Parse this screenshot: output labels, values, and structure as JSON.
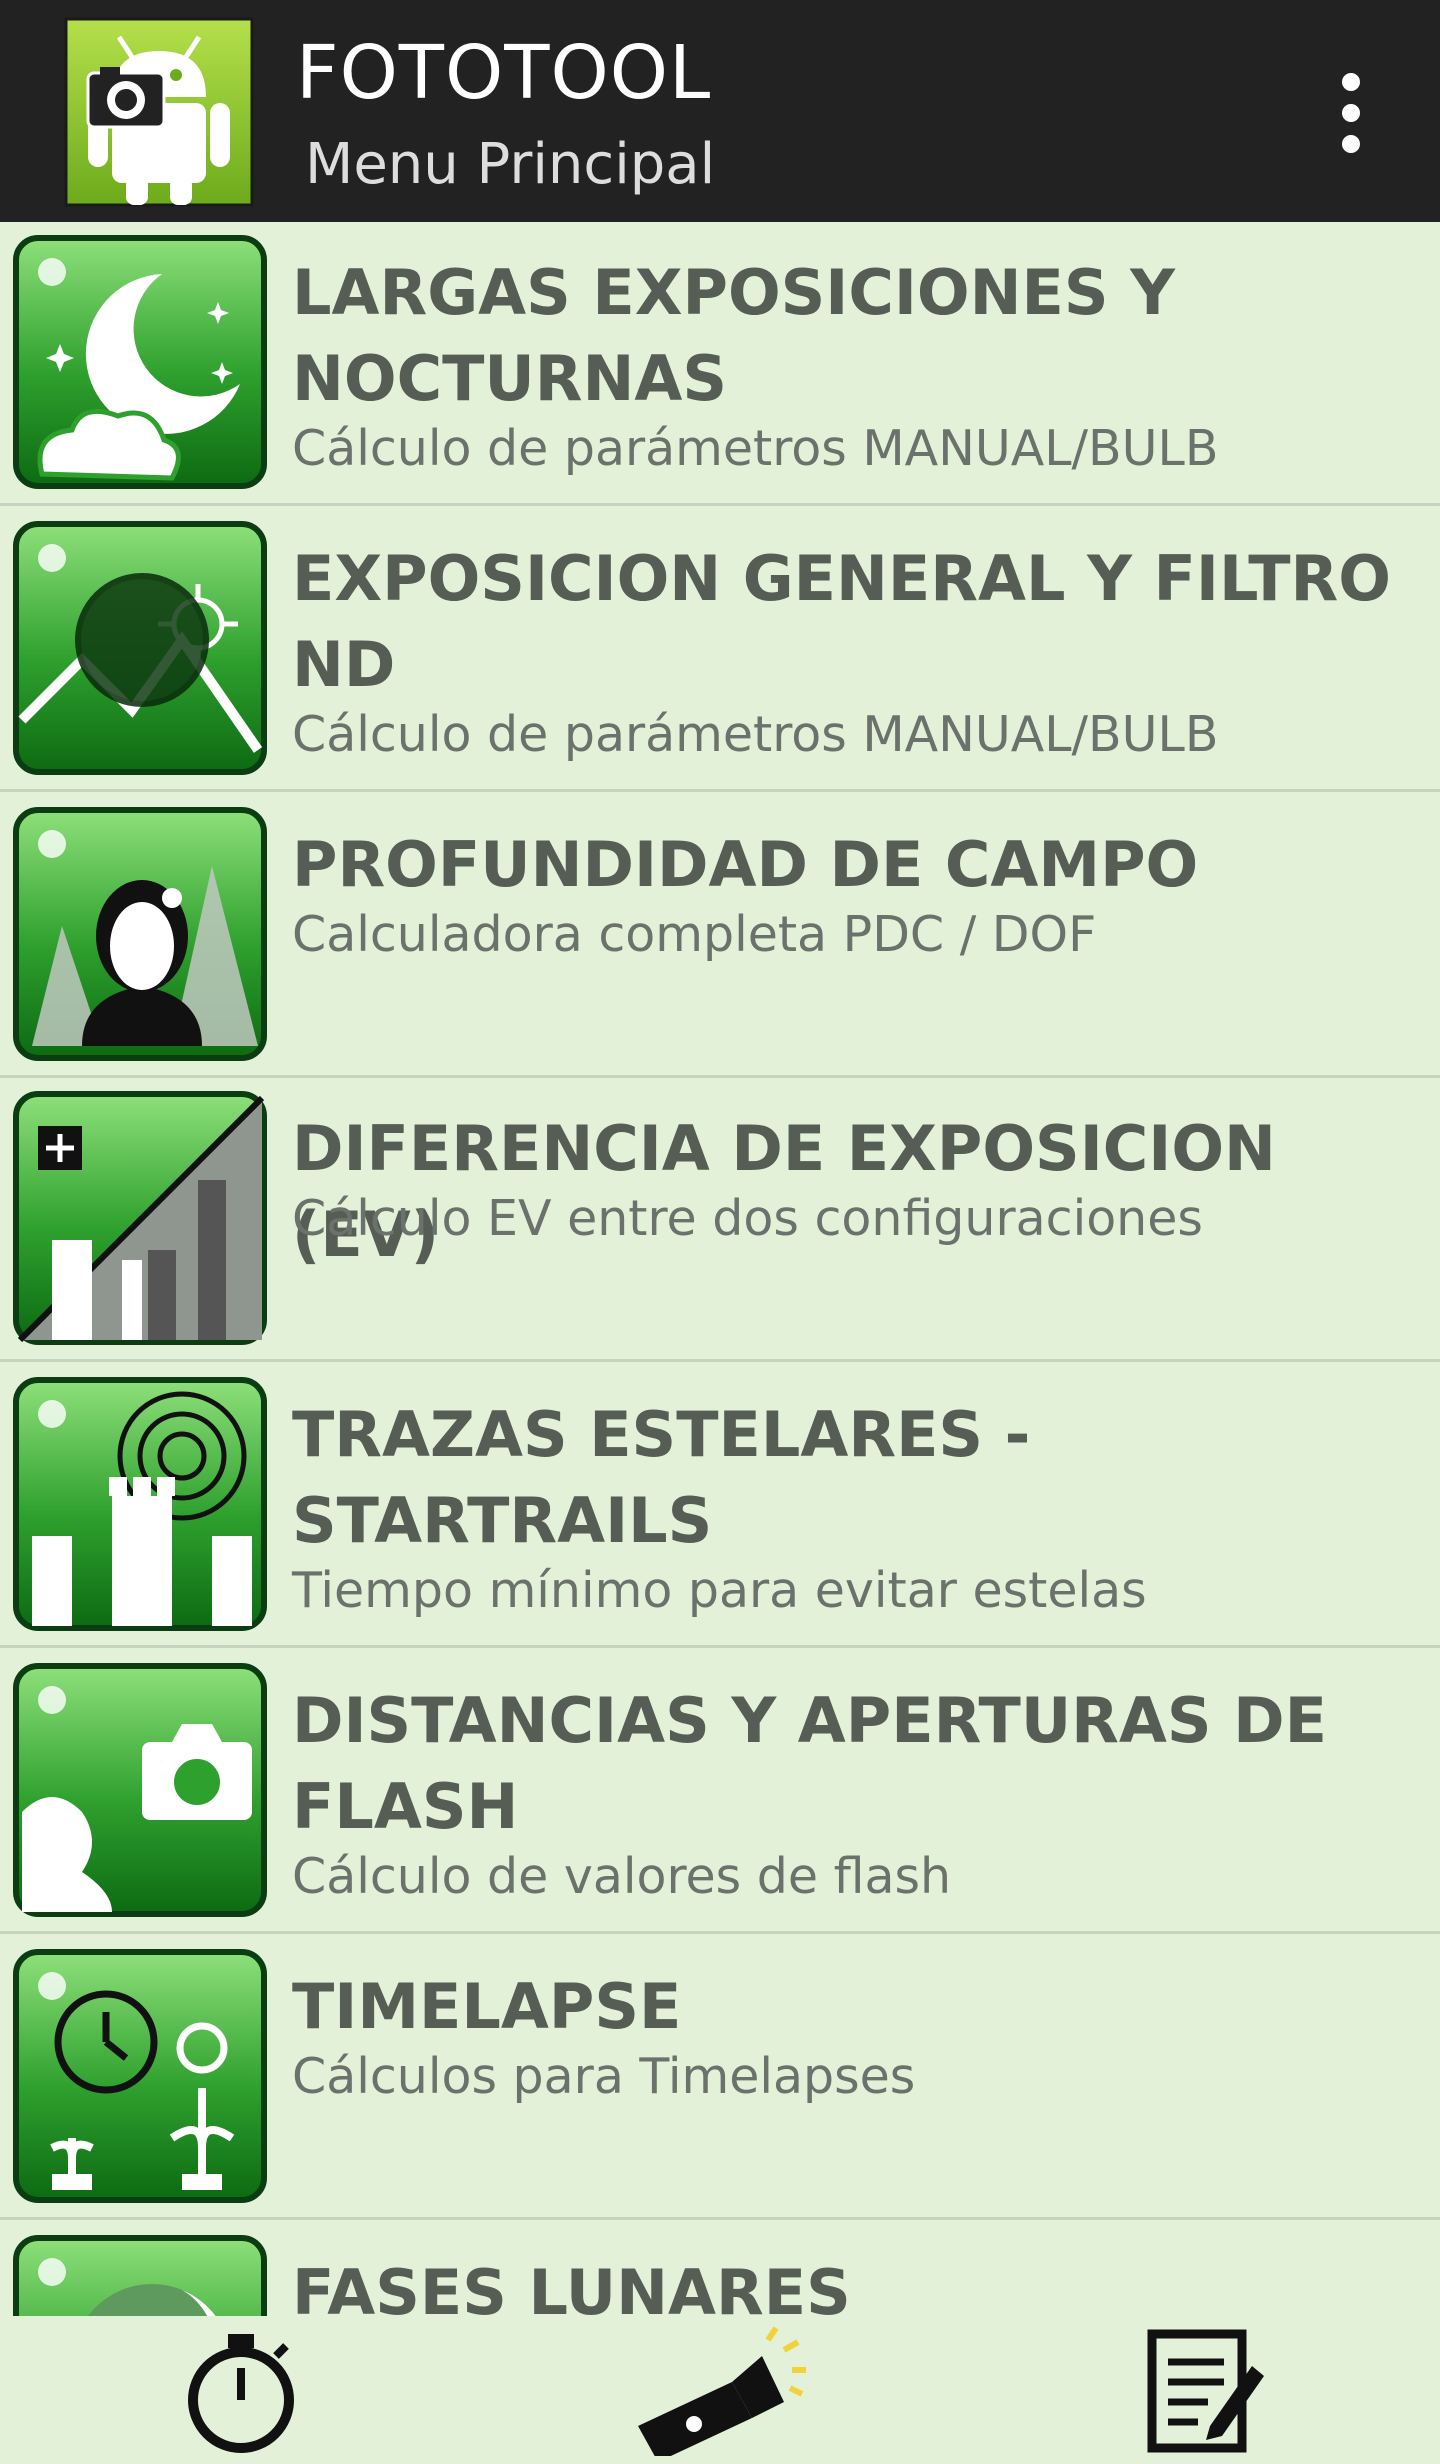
{
  "appbar": {
    "title": "FOTOTOOL",
    "subtitle": "Menu Principal",
    "logo_icon": "android-camera-icon",
    "menu_icon": "overflow-menu-icon"
  },
  "menu": {
    "items": [
      {
        "title": "LARGAS EXPOSICIONES Y NOCTURNAS",
        "subtitle": "Cálculo de parámetros MANUAL/BULB",
        "icon": "moon-night-icon"
      },
      {
        "title": "EXPOSICION GENERAL Y FILTRO ND",
        "subtitle": "Cálculo de parámetros MANUAL/BULB",
        "icon": "nd-filter-icon"
      },
      {
        "title": "PROFUNDIDAD DE CAMPO",
        "subtitle": "Calculadora completa PDC / DOF",
        "icon": "depth-of-field-icon"
      },
      {
        "title": "DIFERENCIA DE EXPOSICION (EV)",
        "subtitle": "Cálculo EV entre dos configuraciones",
        "icon": "exposure-difference-icon"
      },
      {
        "title": "TRAZAS ESTELARES - STARTRAILS",
        "subtitle": "Tiempo mínimo para evitar estelas",
        "icon": "star-trails-icon"
      },
      {
        "title": "DISTANCIAS Y APERTURAS DE FLASH",
        "subtitle": "Cálculo de valores de flash",
        "icon": "flash-icon"
      },
      {
        "title": "TIMELAPSE",
        "subtitle": "Cálculos para Timelapses",
        "icon": "timelapse-icon"
      },
      {
        "title": "FASES LUNARES",
        "subtitle": "",
        "icon": "moon-phases-icon"
      }
    ]
  },
  "bottombar": {
    "left_icon": "stopwatch-icon",
    "center_icon": "flashlight-icon",
    "right_icon": "notes-icon"
  },
  "colors": {
    "appbar": "#222222",
    "background": "#e3f1d9",
    "accent_green": "#2e9b2e",
    "title_text": "#555d55"
  }
}
